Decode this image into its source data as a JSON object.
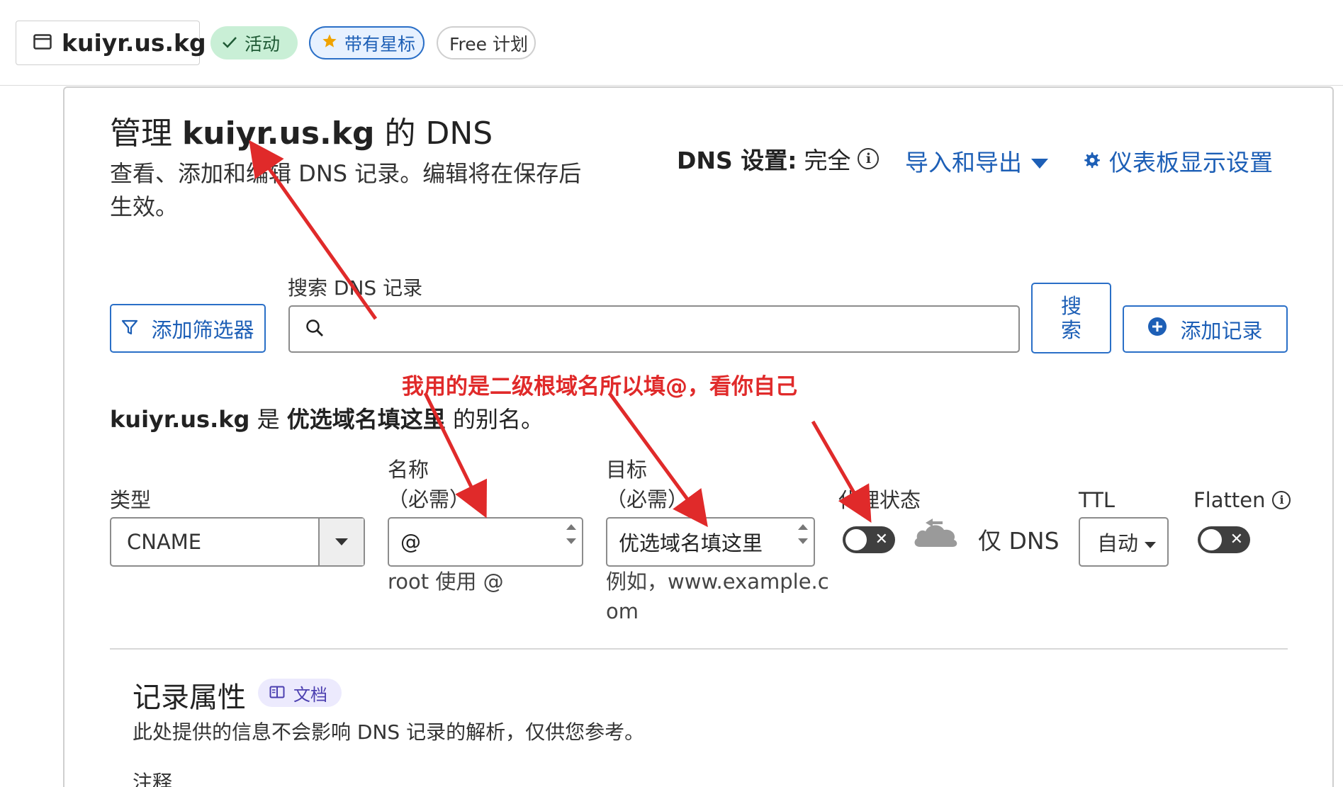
{
  "header": {
    "domain": "kuiyr.us.kg",
    "status_badge": "活动",
    "starred_badge": "带有星标",
    "plan_badge": "Free 计划"
  },
  "page": {
    "title_prefix": "管理",
    "title_domain": "kuiyr.us.kg",
    "title_suffix": "的 DNS",
    "description": "查看、添加和编辑 DNS 记录。编辑将在保存后生效。"
  },
  "dns_settings": {
    "label": "DNS 设置:",
    "value": "完全",
    "import_export": "导入和导出",
    "dashboard_display": "仪表板显示设置"
  },
  "search": {
    "label": "搜索 DNS 记录",
    "value": "",
    "filter_button": "添加筛选器",
    "search_button_line1": "搜",
    "search_button_line2": "索",
    "add_record_button": "添加记录"
  },
  "annotation": {
    "text": "我用的是二级根域名所以填@，看你自己"
  },
  "alias": {
    "domain": "kuiyr.us.kg",
    "is": "是",
    "target": "优选域名填这里",
    "suffix": "的别名。"
  },
  "form": {
    "type_label": "类型",
    "type_value": "CNAME",
    "name_label": "名称",
    "name_required": "（必需）",
    "name_value": "@",
    "name_helper": "root 使用 @",
    "target_label": "目标",
    "target_required": "（必需）",
    "target_value": "优选域名填这里",
    "target_helper_line1": "例如，www.example.c",
    "target_helper_line2": "om",
    "proxy_label": "代理状态",
    "proxy_mode": "仅 DNS",
    "ttl_label": "TTL",
    "ttl_value": "自动",
    "flatten_label": "Flatten"
  },
  "record_attributes": {
    "title": "记录属性",
    "doc_chip": "文档",
    "description": "此处提供的信息不会影响 DNS 记录的解析，仅供您参考。",
    "note_label": "注释"
  },
  "colors": {
    "link_blue": "#1d5fb6",
    "annotation_red": "#e02a2a",
    "active_green": "#c9efd6"
  }
}
